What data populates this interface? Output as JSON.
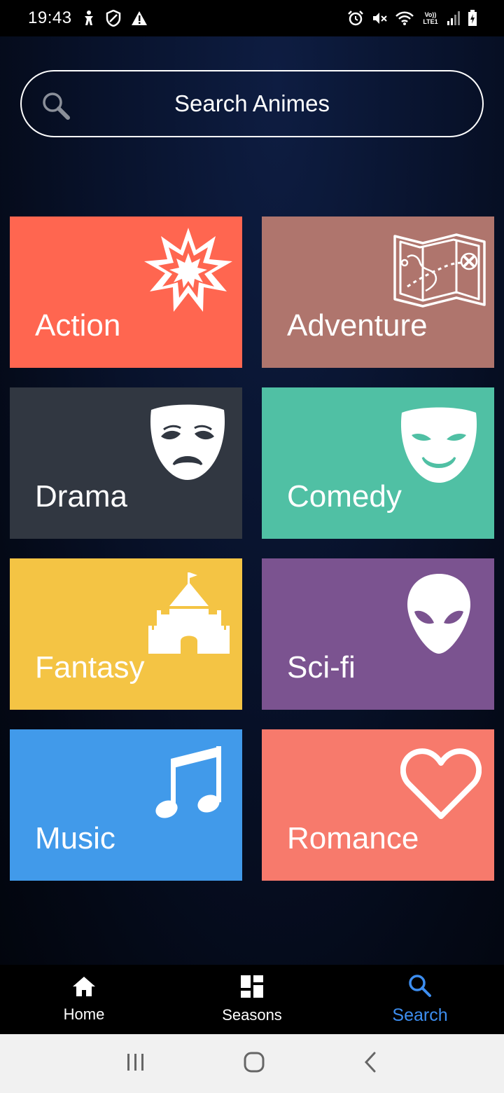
{
  "status_bar": {
    "time": "19:43",
    "icons_left": [
      "accessibility-icon",
      "shield-icon",
      "warning-icon"
    ],
    "icons_right": [
      "alarm-icon",
      "mute-icon",
      "wifi-icon",
      "volte-icon",
      "signal-icon",
      "battery-icon"
    ],
    "volte_text": "Vo)) LTE1"
  },
  "search": {
    "placeholder": "Search Animes",
    "icon": "search-icon"
  },
  "genres": [
    {
      "label": "Action",
      "color": "#ff6650",
      "icon": "explosion-icon"
    },
    {
      "label": "Adventure",
      "color": "#af756d",
      "icon": "treasure-map-icon"
    },
    {
      "label": "Drama",
      "color": "#313741",
      "icon": "sad-mask-icon"
    },
    {
      "label": "Comedy",
      "color": "#50c0a4",
      "icon": "happy-mask-icon"
    },
    {
      "label": "Fantasy",
      "color": "#f4c444",
      "icon": "castle-icon"
    },
    {
      "label": "Sci-fi",
      "color": "#7b5390",
      "icon": "alien-icon"
    },
    {
      "label": "Music",
      "color": "#419aea",
      "icon": "music-note-icon"
    },
    {
      "label": "Romance",
      "color": "#f77a6c",
      "icon": "heart-icon"
    }
  ],
  "bottom_nav": {
    "items": [
      {
        "label": "Home",
        "icon": "home-icon",
        "active": false
      },
      {
        "label": "Seasons",
        "icon": "seasons-grid-icon",
        "active": false
      },
      {
        "label": "Search",
        "icon": "search-icon",
        "active": true
      }
    ],
    "active_color": "#3d8ef0"
  },
  "system_nav": [
    "recent-apps-icon",
    "home-circle-icon",
    "back-icon"
  ]
}
